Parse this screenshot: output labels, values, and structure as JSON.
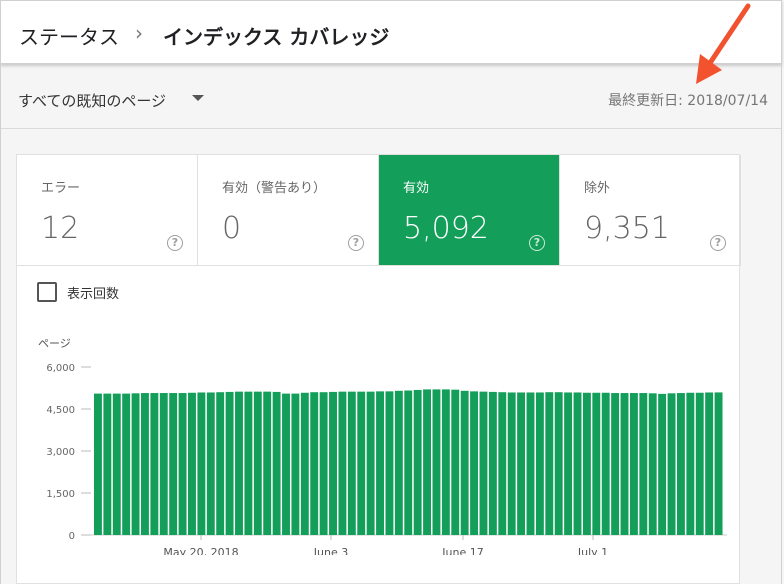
{
  "breadcrumb": {
    "root": "ステータス",
    "separator": "›",
    "current": "インデックス カバレッジ"
  },
  "filter": {
    "selected": "すべての既知のページ"
  },
  "last_updated": "最終更新日: 2018/07/14",
  "tiles": [
    {
      "label": "エラー",
      "value": "12"
    },
    {
      "label": "有効（警告あり）",
      "value": "0"
    },
    {
      "label": "有効",
      "value": "5,092"
    },
    {
      "label": "除外",
      "value": "9,351"
    }
  ],
  "checkbox": {
    "label": "表示回数"
  },
  "colors": {
    "valid_green": "#139e59",
    "annotation_arrow": "#f2522e"
  },
  "chart_data": {
    "type": "bar",
    "ylabel": "ページ",
    "yticks": [
      "6,000",
      "4,500",
      "3,000",
      "1,500",
      "0"
    ],
    "ylim": [
      0,
      6000
    ],
    "xticks": [
      "May 20, 2018",
      "June 3",
      "June 17",
      "July 1"
    ],
    "series": [
      {
        "values": [
          5050,
          5050,
          5050,
          5050,
          5060,
          5070,
          5070,
          5070,
          5070,
          5070,
          5080,
          5090,
          5090,
          5100,
          5110,
          5120,
          5120,
          5120,
          5120,
          5110,
          5050,
          5050,
          5080,
          5100,
          5100,
          5110,
          5120,
          5120,
          5120,
          5120,
          5130,
          5130,
          5150,
          5160,
          5180,
          5200,
          5200,
          5200,
          5190,
          5150,
          5130,
          5120,
          5110,
          5100,
          5090,
          5090,
          5090,
          5090,
          5100,
          5100,
          5090,
          5090,
          5080,
          5080,
          5080,
          5070,
          5070,
          5070,
          5070,
          5060,
          5040,
          5060,
          5070,
          5080,
          5080,
          5090,
          5092
        ]
      }
    ]
  }
}
